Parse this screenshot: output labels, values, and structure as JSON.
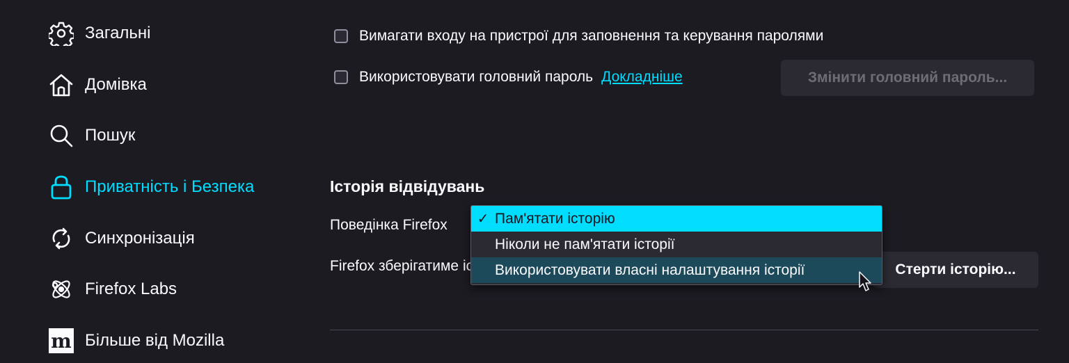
{
  "sidebar": {
    "items": [
      {
        "label": "Загальні",
        "icon": "gear-icon"
      },
      {
        "label": "Домівка",
        "icon": "home-icon"
      },
      {
        "label": "Пошук",
        "icon": "search-icon"
      },
      {
        "label": "Приватність і Безпека",
        "icon": "lock-icon",
        "active": true
      },
      {
        "label": "Синхронізація",
        "icon": "sync-icon"
      },
      {
        "label": "Firefox Labs",
        "icon": "atom-icon"
      },
      {
        "label": "Більше від Mozilla",
        "icon": "mozilla-logo-icon"
      }
    ]
  },
  "passwords": {
    "require_device_signin": "Вимагати входу на пристрої для заповнення та керування паролями",
    "use_primary_password": "Використовувати головний пароль",
    "learn_more": "Докладніше",
    "change_primary_password": "Змінити головний пароль..."
  },
  "history": {
    "heading": "Історія відвідувань",
    "behavior_label": "Поведінка Firefox",
    "description": "Firefox зберігатиме історію перегляду, завантажень, форм і пошукових запитів.",
    "clear_button": "Стерти історію...",
    "dropdown": {
      "options": [
        "Пам'ятати історію",
        "Ніколи не пам'ятати історії",
        "Використовувати власні налаштування історії"
      ],
      "selected_index": 0,
      "hovered_index": 2,
      "check_glyph": "✓"
    }
  },
  "colors": {
    "accent": "#00ddff",
    "background": "#1c1b22",
    "button_bg": "#2b2a33",
    "text": "#fbfbfe"
  }
}
